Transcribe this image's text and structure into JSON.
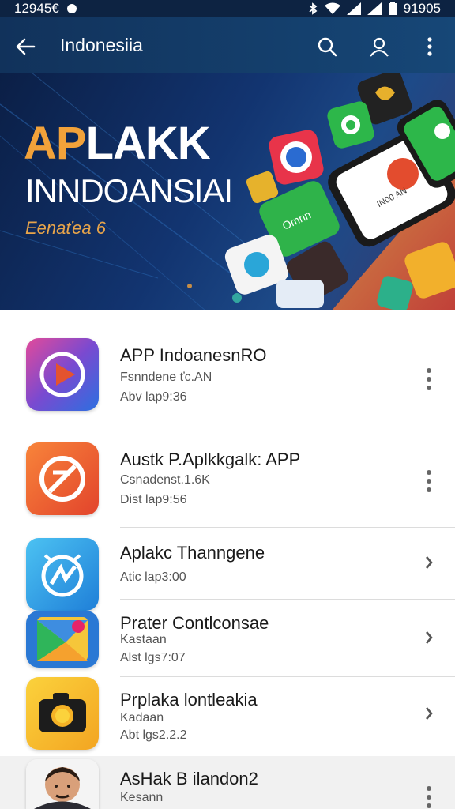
{
  "status_bar": {
    "time": "12945€",
    "right_text": "91905"
  },
  "app_bar": {
    "title": "Indonesiia"
  },
  "banner": {
    "title_part1": "AP",
    "title_part2": "LAKK",
    "title_line2": "INNDOANSIAI",
    "subtitle": "Eenaťea 6"
  },
  "apps": [
    {
      "title": "APP IndoanesnRO",
      "line1": "Fsnndene ťc.AN",
      "line2": "Abv lap9:36",
      "icon": "play-icon",
      "menu": "more-vertical-icon"
    },
    {
      "title": "Austk P.Aplkkgalk: APP",
      "line1": "Csnadenst.1.6K",
      "line2": "Dist lap9:56",
      "icon": "no-entry-icon",
      "menu": "more-vertical-icon"
    },
    {
      "title": "Aplakc Thanngene",
      "line1": "",
      "line2": "Atic lap3:00",
      "icon": "compass-icon",
      "menu": "chevron-right-icon"
    },
    {
      "title": "Prater Contlconsae",
      "line1": "Kastaan",
      "line2": "Alst lgs7:07",
      "icon": "play-store-icon",
      "menu": "chevron-right-icon"
    },
    {
      "title": "Prplaka lontleakia",
      "line1": "Kadaan",
      "line2": "Abt lgs2.2.2",
      "icon": "camera-icon",
      "menu": "chevron-right-icon"
    },
    {
      "title": "AsHak B ilandon2",
      "line1": "Kesann",
      "line2": "",
      "icon": "avatar-icon",
      "menu": "more-vertical-icon"
    }
  ],
  "colors": {
    "app_bar": "#11325b",
    "banner_accent": "#f2a23a",
    "status_bar": "#0d2342"
  }
}
